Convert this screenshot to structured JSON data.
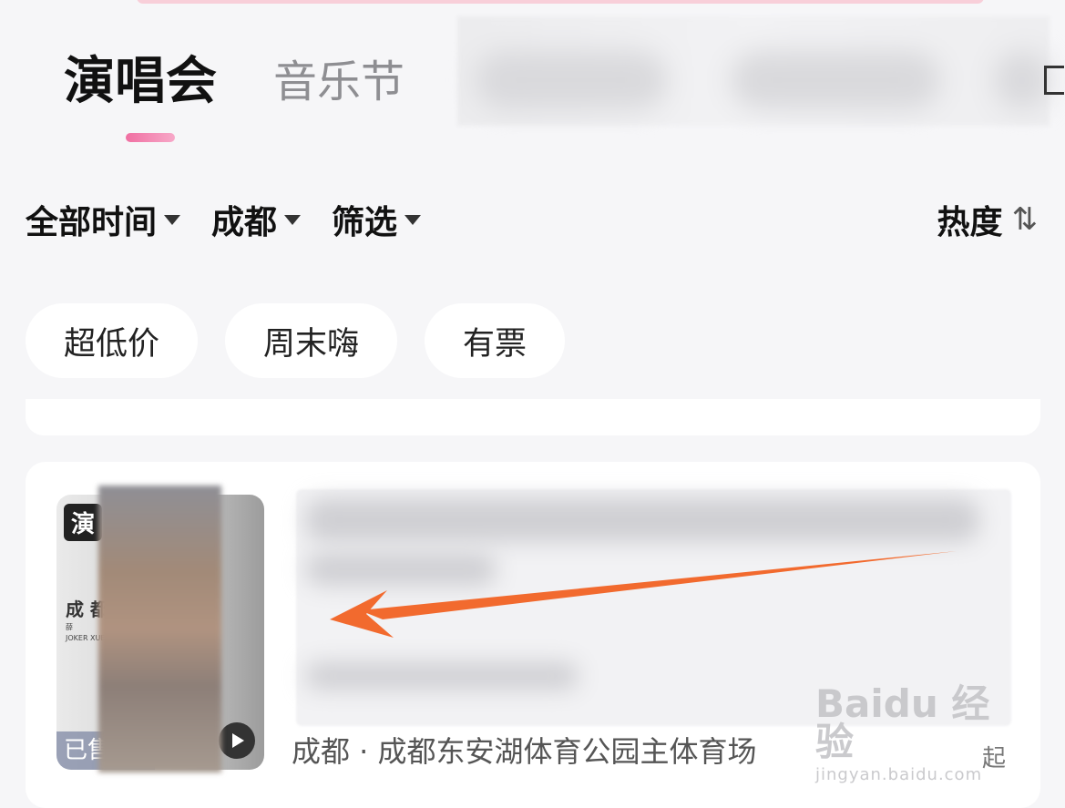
{
  "header": {
    "tabs": [
      {
        "label": "演唱会",
        "active": true
      },
      {
        "label": "音乐节",
        "active": false
      }
    ],
    "accent_color": "#f06fa2"
  },
  "filters": {
    "time": "全部时间",
    "city": "成都",
    "screen": "筛选",
    "sort": "热度",
    "sort_icon": "sort-updown-icon"
  },
  "chips": [
    "超低价",
    "周末嗨",
    "有票"
  ],
  "event_card": {
    "poster": {
      "tag": "演",
      "city_text": "成 都",
      "artist_text": "薛",
      "artist_en": "JOKER XUE",
      "sold_badge": "已售"
    },
    "venue": "成都 · 成都东安湖体育公园主体育场",
    "price_suffix": "起"
  },
  "watermark": {
    "main": "Baidu 经验",
    "sub": "jingyan.baidu.com"
  }
}
